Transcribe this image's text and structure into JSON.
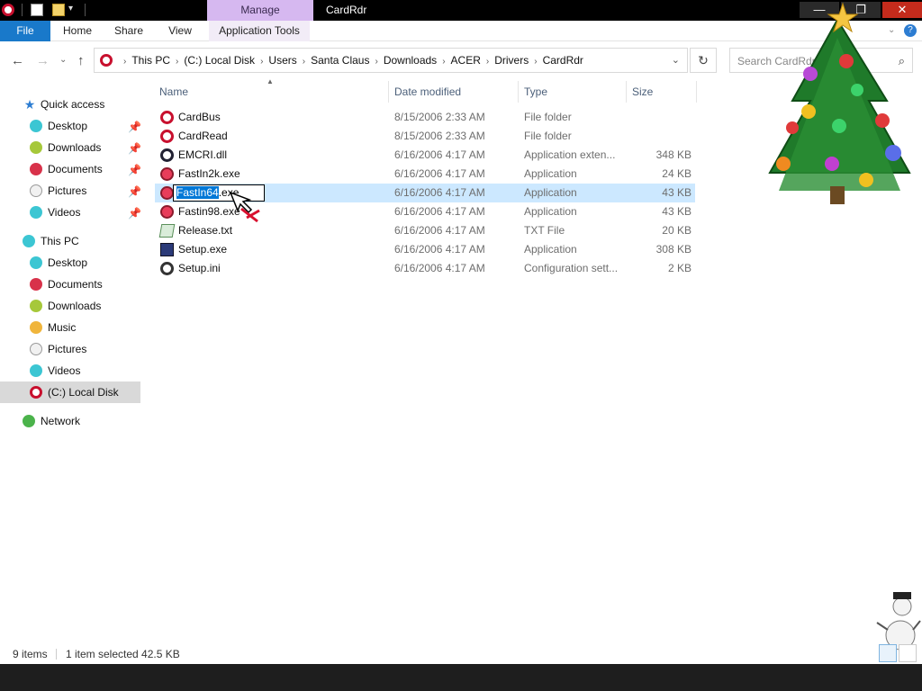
{
  "window": {
    "title": "CardRdr",
    "manage_tab": "Manage",
    "min_glyph": "—",
    "max_glyph": "❐",
    "close_glyph": "✕"
  },
  "ribbon": {
    "tabs": [
      "File",
      "Home",
      "Share",
      "View",
      "Application Tools"
    ]
  },
  "address": {
    "crumbs": [
      "This PC",
      "(C:) Local Disk",
      "Users",
      "Santa Claus",
      "Downloads",
      "ACER",
      "Drivers",
      "CardRdr"
    ],
    "search_placeholder": "Search CardRdr"
  },
  "navpane": {
    "quick_access": "Quick access",
    "quick_items": [
      {
        "label": "Desktop",
        "icon": "desktop-ornament-icon",
        "pinned": true
      },
      {
        "label": "Downloads",
        "icon": "downloads-ornament-icon",
        "pinned": true
      },
      {
        "label": "Documents",
        "icon": "documents-ornament-icon",
        "pinned": true
      },
      {
        "label": "Pictures",
        "icon": "pictures-ornament-icon",
        "pinned": true
      },
      {
        "label": "Videos",
        "icon": "videos-ornament-icon",
        "pinned": true
      }
    ],
    "this_pc": "This PC",
    "pc_items": [
      {
        "label": "Desktop"
      },
      {
        "label": "Documents"
      },
      {
        "label": "Downloads"
      },
      {
        "label": "Music"
      },
      {
        "label": "Pictures"
      },
      {
        "label": "Videos"
      },
      {
        "label": "(C:) Local Disk",
        "selected": true
      }
    ],
    "network": "Network"
  },
  "filelist": {
    "columns": [
      "Name",
      "Date modified",
      "Type",
      "Size"
    ],
    "rows": [
      {
        "name": "CardBus",
        "date": "8/15/2006 2:33 AM",
        "type": "File folder",
        "size": "",
        "icon": "folder"
      },
      {
        "name": "CardRead",
        "date": "8/15/2006 2:33 AM",
        "type": "File folder",
        "size": "",
        "icon": "folder"
      },
      {
        "name": "EMCRI.dll",
        "date": "6/16/2006 4:17 AM",
        "type": "Application exten...",
        "size": "348 KB",
        "icon": "dll"
      },
      {
        "name": "FastIn2k.exe",
        "date": "6/16/2006 4:17 AM",
        "type": "Application",
        "size": "24 KB",
        "icon": "exe"
      },
      {
        "name": "FastIn64.exe",
        "date": "6/16/2006 4:17 AM",
        "type": "Application",
        "size": "43 KB",
        "icon": "exe",
        "selected": true
      },
      {
        "name": "Fastin98.exe",
        "date": "6/16/2006 4:17 AM",
        "type": "Application",
        "size": "43 KB",
        "icon": "exe"
      },
      {
        "name": "Release.txt",
        "date": "6/16/2006 4:17 AM",
        "type": "TXT File",
        "size": "20 KB",
        "icon": "txt"
      },
      {
        "name": "Setup.exe",
        "date": "6/16/2006 4:17 AM",
        "type": "Application",
        "size": "308 KB",
        "icon": "setup"
      },
      {
        "name": "Setup.ini",
        "date": "6/16/2006 4:17 AM",
        "type": "Configuration sett...",
        "size": "2 KB",
        "icon": "ini"
      }
    ],
    "rename": {
      "selected_part": "FastIn64",
      "rest": ".exe"
    }
  },
  "status": {
    "count": "9 items",
    "selection": "1 item selected  42.5 KB"
  },
  "colors": {
    "accent": "#1979ca",
    "selection": "#cce8ff",
    "manage_tab": "#d6b8f0"
  }
}
